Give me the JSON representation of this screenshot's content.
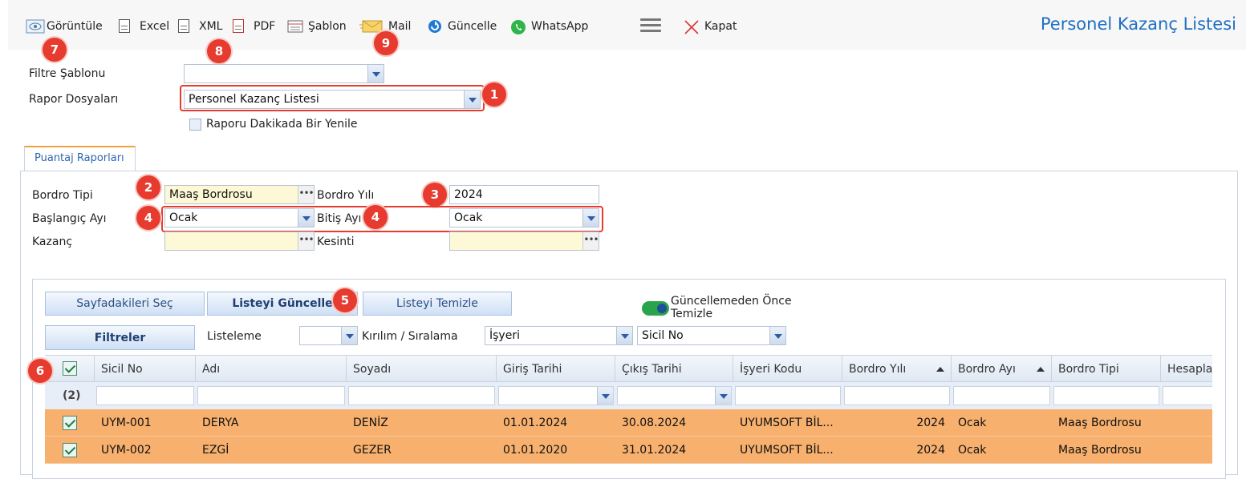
{
  "toolbar": {
    "view_label": "Görüntüle",
    "excel_label": "Excel",
    "xml_label": "XML",
    "pdf_label": "PDF",
    "template_label": "Şablon",
    "mail_label": "Mail",
    "refresh_label": "Güncelle",
    "whatsapp_label": "WhatsApp",
    "close_label": "Kapat",
    "title": "Personel Kazanç Listesi"
  },
  "badges": {
    "b1": "1",
    "b2": "2",
    "b3": "3",
    "b4": "4",
    "b5": "5",
    "b6": "6",
    "b7": "7",
    "b8": "8",
    "b9": "9"
  },
  "filters": {
    "template_label": "Filtre Şablonu",
    "template_value": "",
    "report_files_label": "Rapor Dosyaları",
    "report_files_value": "Personel Kazanç Listesi",
    "auto_refresh_label": "Raporu Dakikada Bir Yenile"
  },
  "tab": {
    "label": "Puantaj Raporları"
  },
  "form": {
    "payroll_type_label": "Bordro Tipi",
    "payroll_type_value": "Maaş Bordrosu",
    "payroll_year_label": "Bordro Yılı",
    "payroll_year_value": "2024",
    "start_month_label": "Başlangıç Ayı",
    "start_month_value": "Ocak",
    "end_month_label": "Bitiş Ayı",
    "end_month_value": "Ocak",
    "earning_label": "Kazanç",
    "deduction_label": "Kesinti"
  },
  "actions": {
    "select_page": "Sayfadakileri Seç",
    "update_list": "Listeyi Güncelle",
    "clear_list": "Listeyi Temizle",
    "toggle_label_1": "Güncellemeden Önce",
    "toggle_label_2": "Temizle",
    "filters_button": "Filtreler",
    "listing_label": "Listeleme",
    "breakdown_label": "Kırılım / Sıralama",
    "breakdown_value_1": "İşyeri",
    "breakdown_value_2": "Sicil No"
  },
  "grid": {
    "columns": [
      "Sicil No",
      "Adı",
      "Soyadı",
      "Giriş Tarihi",
      "Çıkış Tarihi",
      "İşyeri Kodu",
      "Bordro Yılı",
      "Bordro Ayı",
      "Bordro Tipi",
      "Hesaplan"
    ],
    "count_label": "(2)",
    "rows": [
      {
        "sicil": "UYM-001",
        "ad": "DERYA",
        "soyad": "DENİZ",
        "giris": "01.01.2024",
        "cikis": "30.08.2024",
        "isyeri": "UYUMSOFT BİL...",
        "yil": "2024",
        "ay": "Ocak",
        "tip": "Maaş Bordrosu"
      },
      {
        "sicil": "UYM-002",
        "ad": "EZGİ",
        "soyad": "GEZER",
        "giris": "01.01.2020",
        "cikis": "31.01.2024",
        "isyeri": "UYUMSOFT BİL...",
        "yil": "2024",
        "ay": "Ocak",
        "tip": "Maaş Bordrosu"
      }
    ]
  },
  "colors": {
    "accent": "#1f6fc1",
    "badge": "#e63b2e",
    "row_selected": "#f7b06d"
  }
}
